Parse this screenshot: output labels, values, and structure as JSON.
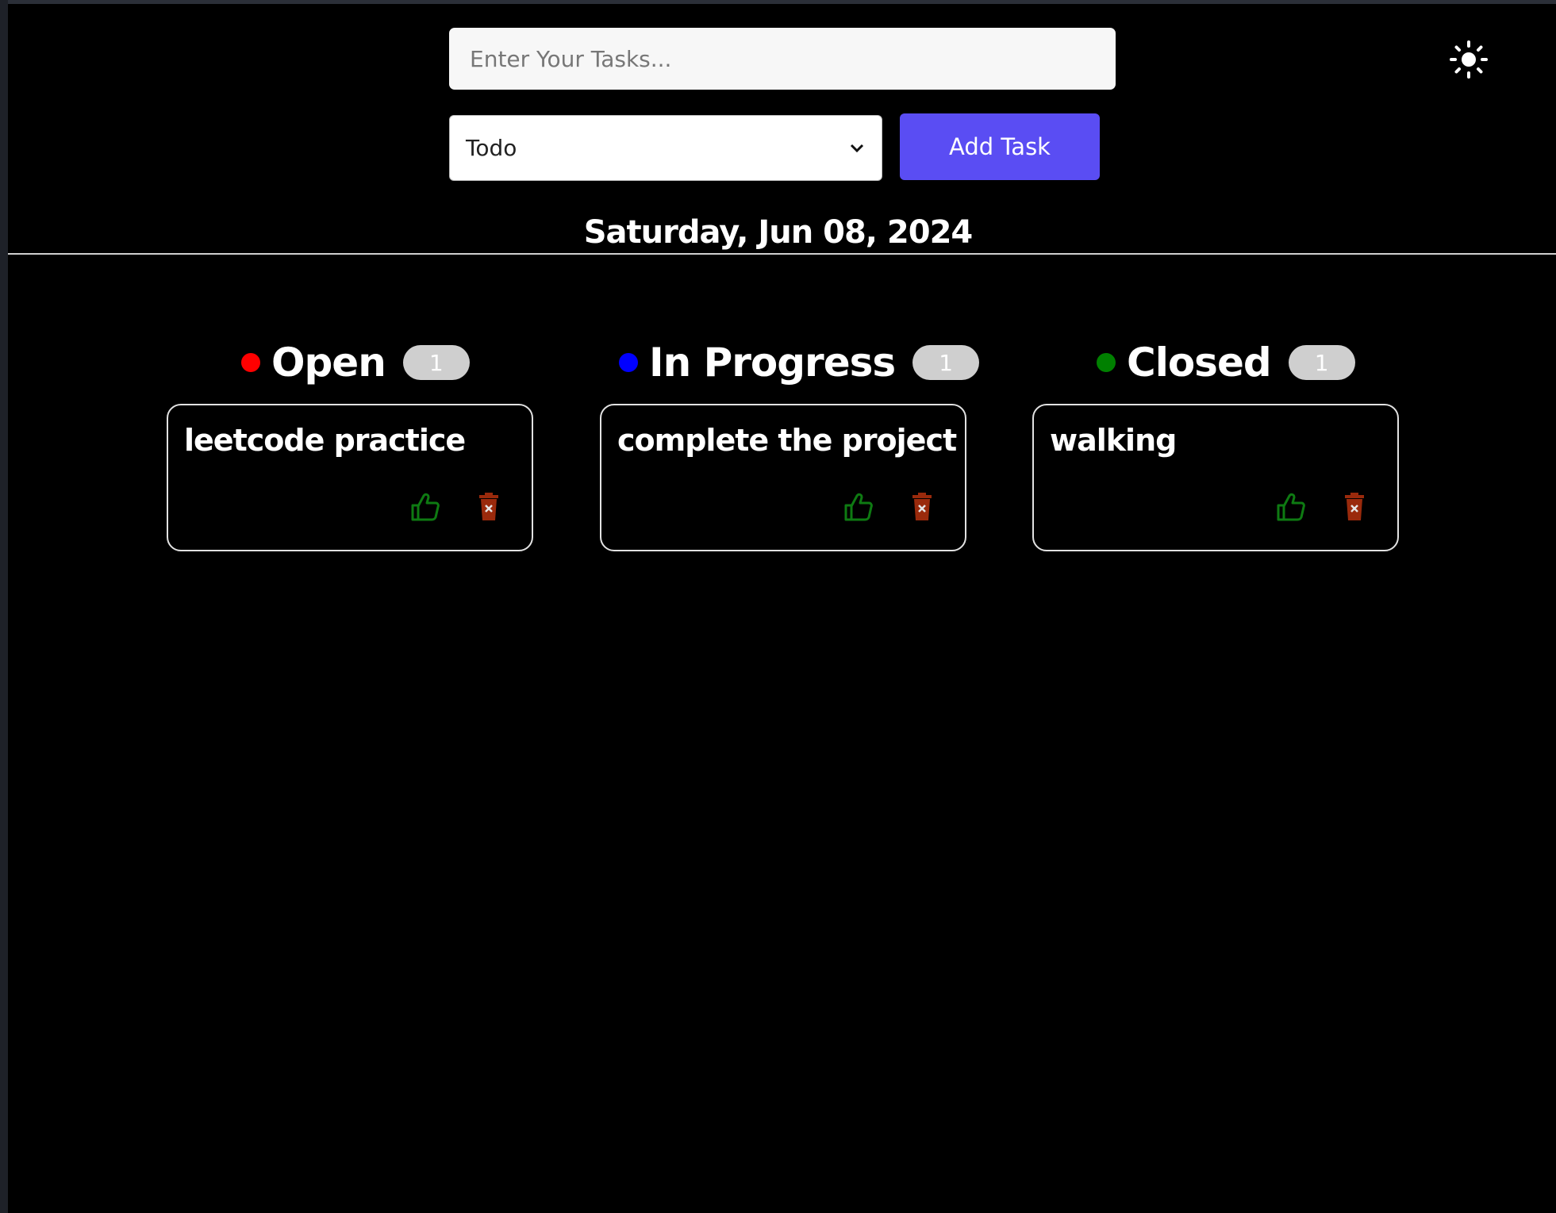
{
  "form": {
    "task_placeholder": "Enter Your Tasks...",
    "status_selected": "Todo",
    "add_label": "Add Task"
  },
  "theme_toggle": {
    "icon": "sun-icon"
  },
  "date": "Saturday, Jun 08, 2024",
  "columns": [
    {
      "title": "Open",
      "count": "1",
      "dot_color": "#ff0000",
      "tasks": [
        {
          "text": "leetcode practice"
        }
      ]
    },
    {
      "title": "In Progress",
      "count": "1",
      "dot_color": "#0000ff",
      "tasks": [
        {
          "text": "complete the project"
        }
      ]
    },
    {
      "title": "Closed",
      "count": "1",
      "dot_color": "#008000",
      "tasks": [
        {
          "text": "walking"
        }
      ]
    }
  ],
  "colors": {
    "accent": "#5a4df3",
    "like_icon": "#0e7a12",
    "delete_icon": "#9a2a0c"
  }
}
